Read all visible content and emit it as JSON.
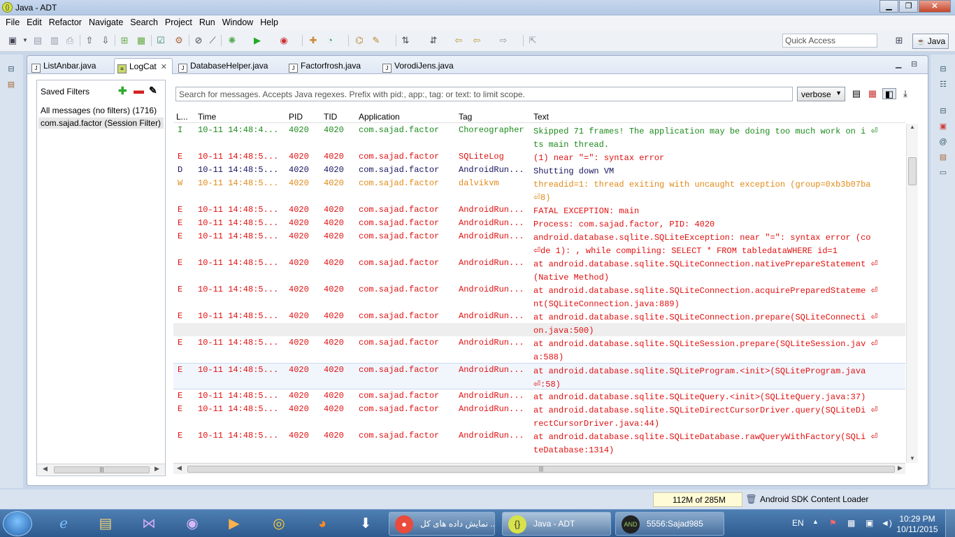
{
  "window": {
    "title": "Java - ADT",
    "app_icon": "adt-icon",
    "buttons": [
      "minimize",
      "maximize",
      "close"
    ]
  },
  "menu": [
    "File",
    "Edit",
    "Refactor",
    "Navigate",
    "Search",
    "Project",
    "Run",
    "Window",
    "Help"
  ],
  "quick_access": {
    "placeholder": "Quick Access"
  },
  "perspective": {
    "label": "Java"
  },
  "tabs": [
    {
      "label": "ListAnbar.java",
      "active": false
    },
    {
      "label": "LogCat",
      "active": true
    },
    {
      "label": "DatabaseHelper.java",
      "active": false
    },
    {
      "label": "Factorfrosh.java",
      "active": false
    },
    {
      "label": "VorodiJens.java",
      "active": false
    }
  ],
  "saved_filters": {
    "title": "Saved Filters",
    "items": [
      {
        "label": "All messages (no filters) (1716)",
        "selected": false
      },
      {
        "label": "com.sajad.factor (Session Filter)",
        "selected": true
      }
    ]
  },
  "logcat": {
    "search_placeholder": "Search for messages. Accepts Java regexes. Prefix with pid:, app:, tag: or text: to limit scope.",
    "level_select": "verbose",
    "columns": [
      "L...",
      "Time",
      "PID",
      "TID",
      "Application",
      "Tag",
      "Text"
    ],
    "rows": [
      {
        "level": "I",
        "time": "10-11 14:48:4...",
        "pid": "4020",
        "tid": "4020",
        "app": "com.sajad.factor",
        "tag": "Choreographer",
        "text": "Skipped 71 frames!  The application may be doing too much work on i ⏎ts main thread."
      },
      {
        "level": "E",
        "time": "10-11 14:48:5...",
        "pid": "4020",
        "tid": "4020",
        "app": "com.sajad.factor",
        "tag": "SQLiteLog",
        "text": "(1) near \"=\": syntax error"
      },
      {
        "level": "D",
        "time": "10-11 14:48:5...",
        "pid": "4020",
        "tid": "4020",
        "app": "com.sajad.factor",
        "tag": "AndroidRun...",
        "text": "Shutting down VM"
      },
      {
        "level": "W",
        "time": "10-11 14:48:5...",
        "pid": "4020",
        "tid": "4020",
        "app": "com.sajad.factor",
        "tag": "dalvikvm",
        "text": "threadid=1: thread exiting with uncaught exception (group=0xb3b07ba ⏎8)"
      },
      {
        "level": "E",
        "time": "10-11 14:48:5...",
        "pid": "4020",
        "tid": "4020",
        "app": "com.sajad.factor",
        "tag": "AndroidRun...",
        "text": "FATAL EXCEPTION: main"
      },
      {
        "level": "E",
        "time": "10-11 14:48:5...",
        "pid": "4020",
        "tid": "4020",
        "app": "com.sajad.factor",
        "tag": "AndroidRun...",
        "text": "Process: com.sajad.factor, PID: 4020"
      },
      {
        "level": "E",
        "time": "10-11 14:48:5...",
        "pid": "4020",
        "tid": "4020",
        "app": "com.sajad.factor",
        "tag": "AndroidRun...",
        "text": "android.database.sqlite.SQLiteException: near \"=\": syntax error (co ⏎de 1): , while compiling: SELECT * FROM tabledataWHERE id=1"
      },
      {
        "level": "E",
        "time": "10-11 14:48:5...",
        "pid": "4020",
        "tid": "4020",
        "app": "com.sajad.factor",
        "tag": "AndroidRun...",
        "text": "at android.database.sqlite.SQLiteConnection.nativePrepareStatement ⏎(Native Method)"
      },
      {
        "level": "E",
        "time": "10-11 14:48:5...",
        "pid": "4020",
        "tid": "4020",
        "app": "com.sajad.factor",
        "tag": "AndroidRun...",
        "text": "at android.database.sqlite.SQLiteConnection.acquirePreparedStateme ⏎nt(SQLiteConnection.java:889)"
      },
      {
        "level": "E",
        "time": "10-11 14:48:5...",
        "pid": "4020",
        "tid": "4020",
        "app": "com.sajad.factor",
        "tag": "AndroidRun...",
        "text": "at android.database.sqlite.SQLiteConnection.prepare(SQLiteConnecti ⏎on.java:500)"
      },
      {
        "level": "E",
        "time": "10-11 14:48:5...",
        "pid": "4020",
        "tid": "4020",
        "app": "com.sajad.factor",
        "tag": "AndroidRun...",
        "text": "at android.database.sqlite.SQLiteSession.prepare(SQLiteSession.jav ⏎a:588)"
      },
      {
        "level": "E",
        "time": "10-11 14:48:5...",
        "pid": "4020",
        "tid": "4020",
        "app": "com.sajad.factor",
        "tag": "AndroidRun...",
        "text": "at android.database.sqlite.SQLiteProgram.<init>(SQLiteProgram.java ⏎:58)"
      },
      {
        "level": "E",
        "time": "10-11 14:48:5...",
        "pid": "4020",
        "tid": "4020",
        "app": "com.sajad.factor",
        "tag": "AndroidRun...",
        "text": "at android.database.sqlite.SQLiteQuery.<init>(SQLiteQuery.java:37)"
      },
      {
        "level": "E",
        "time": "10-11 14:48:5...",
        "pid": "4020",
        "tid": "4020",
        "app": "com.sajad.factor",
        "tag": "AndroidRun...",
        "text": "at android.database.sqlite.SQLiteDirectCursorDriver.query(SQLiteDi ⏎rectCursorDriver.java:44)"
      },
      {
        "level": "E",
        "time": "10-11 14:48:5...",
        "pid": "4020",
        "tid": "4020",
        "app": "com.sajad.factor",
        "tag": "AndroidRun...",
        "text": "at android.database.sqlite.SQLiteDatabase.rawQueryWithFactory(SQLi ⏎teDatabase:1314)"
      }
    ],
    "level_colors": {
      "I": "#1b8a1b",
      "E": "#e01010",
      "D": "#151560",
      "W": "#e08a18"
    }
  },
  "status": {
    "heap": "112M of 285M",
    "job": "Android SDK Content Loader"
  },
  "taskbar": {
    "tasks": [
      {
        "label": "نمایش داده های کل ...",
        "icon": "chrome-icon"
      },
      {
        "label": "Java - ADT",
        "icon": "adt-icon"
      },
      {
        "label": "5556:Sajad985",
        "icon": "android-emulator-icon"
      }
    ],
    "language": "EN",
    "time": "10:29 PM",
    "date": "10/11/2015"
  }
}
